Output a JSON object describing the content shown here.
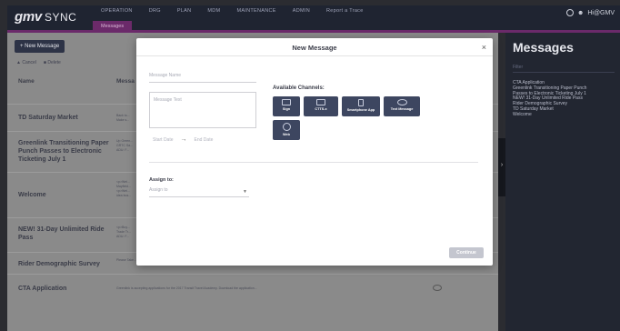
{
  "nav": {
    "brand": "gmv",
    "brand_suffix": "SYNC",
    "links": [
      "OPERATION",
      "DRG",
      "PLAN",
      "MDM",
      "MAINTENANCE",
      "ADMIN",
      "Report a Trace"
    ],
    "subnav": "Messages",
    "user": "Hi@GMV"
  },
  "main": {
    "new_message_label": "+ New Message",
    "toolbar": [
      "Cancel",
      "Delete"
    ],
    "columns": [
      "Name",
      "Messa"
    ],
    "rows": [
      {
        "name": "TD Saturday Market",
        "msg": "Back to... Make s..."
      },
      {
        "name": "Greenlink Transitioning Paper Punch Passes to Electronic Ticketing July 1",
        "msg": "Up Green... GRTC Sa... ADU: F..."
      },
      {
        "name": "Welcome",
        "msg": "<p>Wel... Mayfield... <p>Wel... idea bus..."
      },
      {
        "name": "NEW! 31-Day Unlimited Ride Pass",
        "msg": "<p>Buy... Trade Tr... ADU: F..."
      },
      {
        "name": "Rider Demographic Survey",
        "msg": "Please Take... we want you... survey, and some passes in exchange..."
      },
      {
        "name": "CTA Application",
        "msg": "Greenlink is accepting applications for the 2017 Transit Travel Academy. Download the application..."
      }
    ]
  },
  "rpanel": {
    "title": "Messages",
    "filter_placeholder": "Filter",
    "items": [
      "CTA Application",
      "Greenlink Transitioning Paper Punch",
      "Passes to Electronic Ticketing July 1",
      "NEW! 31-Day Unlimited Ride Pass",
      "Rider Demographic Survey",
      "TD Saturday Market",
      "Welcome"
    ]
  },
  "modal": {
    "title": "New Message",
    "close": "×",
    "message_name_placeholder": "Message Name",
    "message_text_placeholder": "Message Text",
    "start_date_placeholder": "Start Date",
    "end_date_placeholder": "End Date",
    "channels_label": "Available Channels:",
    "channels": [
      "Sign",
      "CTTS-x",
      "Smartphone App",
      "Text Message",
      "Web"
    ],
    "assign_label": "Assign to:",
    "assign_placeholder": "Assign to",
    "continue_label": "Continue"
  }
}
